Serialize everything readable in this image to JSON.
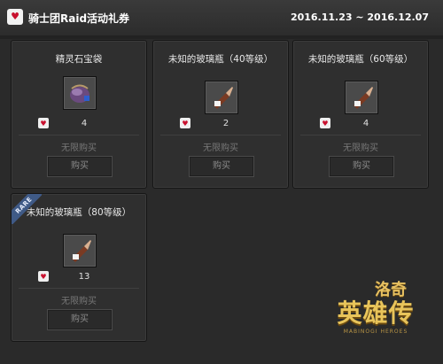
{
  "header": {
    "title": "骑士团Raid活动礼券",
    "dates": "2016.11.23 ~ 2016.12.07",
    "title_icon": "coupon-heart-icon"
  },
  "cards": [
    {
      "name": "精灵石宝袋",
      "icon": "spirit-stone-pouch-icon",
      "quantity": "4",
      "limit": "无限购买",
      "buy_label": "购买",
      "rare": false
    },
    {
      "name": "未知的玻璃瓶（40等级）",
      "icon": "glass-bottle-icon",
      "quantity": "2",
      "limit": "无限购买",
      "buy_label": "购买",
      "rare": false
    },
    {
      "name": "未知的玻璃瓶（60等级）",
      "icon": "glass-bottle-icon",
      "quantity": "4",
      "limit": "无限购买",
      "buy_label": "购买",
      "rare": false
    },
    {
      "name": "未知的玻璃瓶（80等级）",
      "icon": "glass-bottle-icon",
      "quantity": "13",
      "limit": "无限购买",
      "buy_label": "购买",
      "rare": true,
      "rare_label": "RARE"
    }
  ],
  "logo": {
    "top": "洛奇",
    "main": "英雄传",
    "sub": "MABINOGI HEROES"
  },
  "colors": {
    "background": "#2a2a2a",
    "card": "#2f2f2f",
    "accent_gold": "#e8c45a",
    "rare_blue": "#3f5a86"
  }
}
